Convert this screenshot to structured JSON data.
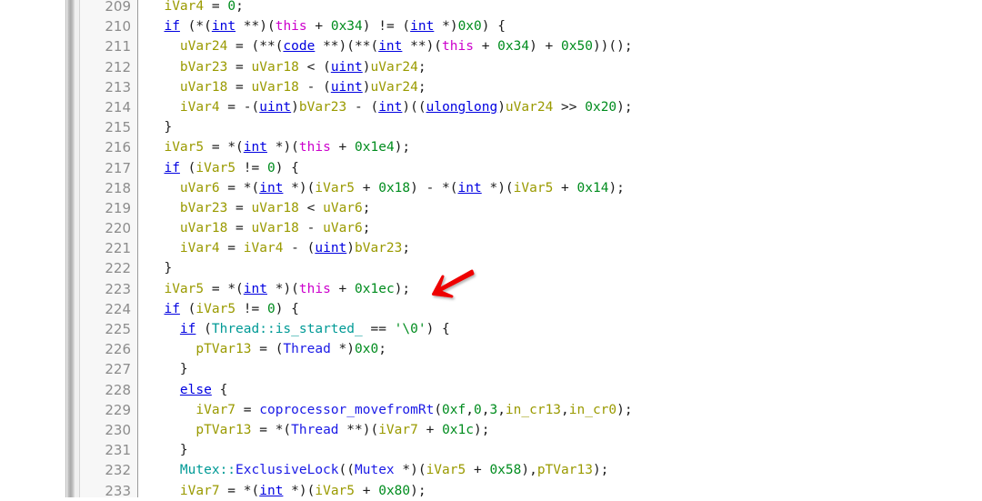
{
  "editor": {
    "kind": "decompiler-code-view",
    "first_line_number": 209,
    "last_line_number": 233,
    "colors": {
      "background": "#ffffff",
      "gutter_background": "#f7f7f7",
      "line_number": "#8c8c8c",
      "keyword": "#0000e0",
      "type": "#0000e0",
      "function": "#1a1ae6",
      "namespace": "#009a96",
      "variable": "#9a9a00",
      "number": "#008c1e",
      "this_keyword": "#cc00cc",
      "plain": "#1b1b1b",
      "annotation_arrow": "#ee0000"
    }
  },
  "annotation": {
    "type": "arrow",
    "color": "#ee0000",
    "points_at_line": 223,
    "direction": "down-left"
  },
  "lines": [
    {
      "n": "209",
      "tokens": [
        {
          "t": "  ",
          "c": "pl"
        },
        {
          "t": "iVar4",
          "c": "var"
        },
        {
          "t": " = ",
          "c": "pl"
        },
        {
          "t": "0",
          "c": "num"
        },
        {
          "t": ";",
          "c": "pl"
        }
      ]
    },
    {
      "n": "210",
      "tokens": [
        {
          "t": "  ",
          "c": "pl"
        },
        {
          "t": "if",
          "c": "kw"
        },
        {
          "t": " (*(",
          "c": "pl"
        },
        {
          "t": "int",
          "c": "ty"
        },
        {
          "t": " **)(",
          "c": "pl"
        },
        {
          "t": "this",
          "c": "this"
        },
        {
          "t": " + ",
          "c": "pl"
        },
        {
          "t": "0x34",
          "c": "num"
        },
        {
          "t": ") != (",
          "c": "pl"
        },
        {
          "t": "int",
          "c": "ty"
        },
        {
          "t": " *)",
          "c": "pl"
        },
        {
          "t": "0x0",
          "c": "num"
        },
        {
          "t": ") {",
          "c": "pl"
        }
      ]
    },
    {
      "n": "211",
      "tokens": [
        {
          "t": "    ",
          "c": "pl"
        },
        {
          "t": "uVar24",
          "c": "var"
        },
        {
          "t": " = (**(",
          "c": "pl"
        },
        {
          "t": "code",
          "c": "ty"
        },
        {
          "t": " **)(**(",
          "c": "pl"
        },
        {
          "t": "int",
          "c": "ty"
        },
        {
          "t": " **)(",
          "c": "pl"
        },
        {
          "t": "this",
          "c": "this"
        },
        {
          "t": " + ",
          "c": "pl"
        },
        {
          "t": "0x34",
          "c": "num"
        },
        {
          "t": ") + ",
          "c": "pl"
        },
        {
          "t": "0x50",
          "c": "num"
        },
        {
          "t": "))();",
          "c": "pl"
        }
      ]
    },
    {
      "n": "212",
      "tokens": [
        {
          "t": "    ",
          "c": "pl"
        },
        {
          "t": "bVar23",
          "c": "var"
        },
        {
          "t": " = ",
          "c": "pl"
        },
        {
          "t": "uVar18",
          "c": "var"
        },
        {
          "t": " < (",
          "c": "pl"
        },
        {
          "t": "uint",
          "c": "ty"
        },
        {
          "t": ")",
          "c": "pl"
        },
        {
          "t": "uVar24",
          "c": "var"
        },
        {
          "t": ";",
          "c": "pl"
        }
      ]
    },
    {
      "n": "213",
      "tokens": [
        {
          "t": "    ",
          "c": "pl"
        },
        {
          "t": "uVar18",
          "c": "var"
        },
        {
          "t": " = ",
          "c": "pl"
        },
        {
          "t": "uVar18",
          "c": "var"
        },
        {
          "t": " - (",
          "c": "pl"
        },
        {
          "t": "uint",
          "c": "ty"
        },
        {
          "t": ")",
          "c": "pl"
        },
        {
          "t": "uVar24",
          "c": "var"
        },
        {
          "t": ";",
          "c": "pl"
        }
      ]
    },
    {
      "n": "214",
      "tokens": [
        {
          "t": "    ",
          "c": "pl"
        },
        {
          "t": "iVar4",
          "c": "var"
        },
        {
          "t": " = -(",
          "c": "pl"
        },
        {
          "t": "uint",
          "c": "ty"
        },
        {
          "t": ")",
          "c": "pl"
        },
        {
          "t": "bVar23",
          "c": "var"
        },
        {
          "t": " - (",
          "c": "pl"
        },
        {
          "t": "int",
          "c": "ty"
        },
        {
          "t": ")((",
          "c": "pl"
        },
        {
          "t": "ulonglong",
          "c": "ty"
        },
        {
          "t": ")",
          "c": "pl"
        },
        {
          "t": "uVar24",
          "c": "var"
        },
        {
          "t": " >> ",
          "c": "pl"
        },
        {
          "t": "0x20",
          "c": "num"
        },
        {
          "t": ");",
          "c": "pl"
        }
      ]
    },
    {
      "n": "215",
      "tokens": [
        {
          "t": "  }",
          "c": "pl"
        }
      ]
    },
    {
      "n": "216",
      "tokens": [
        {
          "t": "  ",
          "c": "pl"
        },
        {
          "t": "iVar5",
          "c": "var"
        },
        {
          "t": " = *(",
          "c": "pl"
        },
        {
          "t": "int",
          "c": "ty"
        },
        {
          "t": " *)(",
          "c": "pl"
        },
        {
          "t": "this",
          "c": "this"
        },
        {
          "t": " + ",
          "c": "pl"
        },
        {
          "t": "0x1e4",
          "c": "num"
        },
        {
          "t": ");",
          "c": "pl"
        }
      ]
    },
    {
      "n": "217",
      "tokens": [
        {
          "t": "  ",
          "c": "pl"
        },
        {
          "t": "if",
          "c": "kw"
        },
        {
          "t": " (",
          "c": "pl"
        },
        {
          "t": "iVar5",
          "c": "var"
        },
        {
          "t": " != ",
          "c": "pl"
        },
        {
          "t": "0",
          "c": "num"
        },
        {
          "t": ") {",
          "c": "pl"
        }
      ]
    },
    {
      "n": "218",
      "tokens": [
        {
          "t": "    ",
          "c": "pl"
        },
        {
          "t": "uVar6",
          "c": "var"
        },
        {
          "t": " = *(",
          "c": "pl"
        },
        {
          "t": "int",
          "c": "ty"
        },
        {
          "t": " *)(",
          "c": "pl"
        },
        {
          "t": "iVar5",
          "c": "var"
        },
        {
          "t": " + ",
          "c": "pl"
        },
        {
          "t": "0x18",
          "c": "num"
        },
        {
          "t": ") - *(",
          "c": "pl"
        },
        {
          "t": "int",
          "c": "ty"
        },
        {
          "t": " *)(",
          "c": "pl"
        },
        {
          "t": "iVar5",
          "c": "var"
        },
        {
          "t": " + ",
          "c": "pl"
        },
        {
          "t": "0x14",
          "c": "num"
        },
        {
          "t": ");",
          "c": "pl"
        }
      ]
    },
    {
      "n": "219",
      "tokens": [
        {
          "t": "    ",
          "c": "pl"
        },
        {
          "t": "bVar23",
          "c": "var"
        },
        {
          "t": " = ",
          "c": "pl"
        },
        {
          "t": "uVar18",
          "c": "var"
        },
        {
          "t": " < ",
          "c": "pl"
        },
        {
          "t": "uVar6",
          "c": "var"
        },
        {
          "t": ";",
          "c": "pl"
        }
      ]
    },
    {
      "n": "220",
      "tokens": [
        {
          "t": "    ",
          "c": "pl"
        },
        {
          "t": "uVar18",
          "c": "var"
        },
        {
          "t": " = ",
          "c": "pl"
        },
        {
          "t": "uVar18",
          "c": "var"
        },
        {
          "t": " - ",
          "c": "pl"
        },
        {
          "t": "uVar6",
          "c": "var"
        },
        {
          "t": ";",
          "c": "pl"
        }
      ]
    },
    {
      "n": "221",
      "tokens": [
        {
          "t": "    ",
          "c": "pl"
        },
        {
          "t": "iVar4",
          "c": "var"
        },
        {
          "t": " = ",
          "c": "pl"
        },
        {
          "t": "iVar4",
          "c": "var"
        },
        {
          "t": " - (",
          "c": "pl"
        },
        {
          "t": "uint",
          "c": "ty"
        },
        {
          "t": ")",
          "c": "pl"
        },
        {
          "t": "bVar23",
          "c": "var"
        },
        {
          "t": ";",
          "c": "pl"
        }
      ]
    },
    {
      "n": "222",
      "tokens": [
        {
          "t": "  }",
          "c": "pl"
        }
      ]
    },
    {
      "n": "223",
      "tokens": [
        {
          "t": "  ",
          "c": "pl"
        },
        {
          "t": "iVar5",
          "c": "var"
        },
        {
          "t": " = *(",
          "c": "pl"
        },
        {
          "t": "int",
          "c": "ty"
        },
        {
          "t": " *)(",
          "c": "pl"
        },
        {
          "t": "this",
          "c": "this"
        },
        {
          "t": " + ",
          "c": "pl"
        },
        {
          "t": "0x1ec",
          "c": "num"
        },
        {
          "t": ");",
          "c": "pl"
        }
      ]
    },
    {
      "n": "224",
      "tokens": [
        {
          "t": "  ",
          "c": "pl"
        },
        {
          "t": "if",
          "c": "kw"
        },
        {
          "t": " (",
          "c": "pl"
        },
        {
          "t": "iVar5",
          "c": "var"
        },
        {
          "t": " != ",
          "c": "pl"
        },
        {
          "t": "0",
          "c": "num"
        },
        {
          "t": ") {",
          "c": "pl"
        }
      ]
    },
    {
      "n": "225",
      "tokens": [
        {
          "t": "    ",
          "c": "pl"
        },
        {
          "t": "if",
          "c": "kw"
        },
        {
          "t": " (",
          "c": "pl"
        },
        {
          "t": "Thread::is_started_",
          "c": "ns"
        },
        {
          "t": " == ",
          "c": "pl"
        },
        {
          "t": "'\\0'",
          "c": "num"
        },
        {
          "t": ") {",
          "c": "pl"
        }
      ]
    },
    {
      "n": "226",
      "tokens": [
        {
          "t": "      ",
          "c": "pl"
        },
        {
          "t": "pTVar13",
          "c": "var"
        },
        {
          "t": " = (",
          "c": "pl"
        },
        {
          "t": "Thread",
          "c": "fn"
        },
        {
          "t": " *)",
          "c": "pl"
        },
        {
          "t": "0x0",
          "c": "num"
        },
        {
          "t": ";",
          "c": "pl"
        }
      ]
    },
    {
      "n": "227",
      "tokens": [
        {
          "t": "    }",
          "c": "pl"
        }
      ]
    },
    {
      "n": "228",
      "tokens": [
        {
          "t": "    ",
          "c": "pl"
        },
        {
          "t": "else",
          "c": "kw"
        },
        {
          "t": " {",
          "c": "pl"
        }
      ]
    },
    {
      "n": "229",
      "tokens": [
        {
          "t": "      ",
          "c": "pl"
        },
        {
          "t": "iVar7",
          "c": "var"
        },
        {
          "t": " = ",
          "c": "pl"
        },
        {
          "t": "coprocessor_movefromRt",
          "c": "fn"
        },
        {
          "t": "(",
          "c": "pl"
        },
        {
          "t": "0xf",
          "c": "num"
        },
        {
          "t": ",",
          "c": "pl"
        },
        {
          "t": "0",
          "c": "num"
        },
        {
          "t": ",",
          "c": "pl"
        },
        {
          "t": "3",
          "c": "num"
        },
        {
          "t": ",",
          "c": "pl"
        },
        {
          "t": "in_cr13",
          "c": "var"
        },
        {
          "t": ",",
          "c": "pl"
        },
        {
          "t": "in_cr0",
          "c": "var"
        },
        {
          "t": ");",
          "c": "pl"
        }
      ]
    },
    {
      "n": "230",
      "tokens": [
        {
          "t": "      ",
          "c": "pl"
        },
        {
          "t": "pTVar13",
          "c": "var"
        },
        {
          "t": " = *(",
          "c": "pl"
        },
        {
          "t": "Thread",
          "c": "fn"
        },
        {
          "t": " **)(",
          "c": "pl"
        },
        {
          "t": "iVar7",
          "c": "var"
        },
        {
          "t": " + ",
          "c": "pl"
        },
        {
          "t": "0x1c",
          "c": "num"
        },
        {
          "t": ");",
          "c": "pl"
        }
      ]
    },
    {
      "n": "231",
      "tokens": [
        {
          "t": "    }",
          "c": "pl"
        }
      ]
    },
    {
      "n": "232",
      "tokens": [
        {
          "t": "    ",
          "c": "pl"
        },
        {
          "t": "Mutex::",
          "c": "ns"
        },
        {
          "t": "ExclusiveLock",
          "c": "fn"
        },
        {
          "t": "((",
          "c": "pl"
        },
        {
          "t": "Mutex",
          "c": "fn"
        },
        {
          "t": " *)(",
          "c": "pl"
        },
        {
          "t": "iVar5",
          "c": "var"
        },
        {
          "t": " + ",
          "c": "pl"
        },
        {
          "t": "0x58",
          "c": "num"
        },
        {
          "t": "),",
          "c": "pl"
        },
        {
          "t": "pTVar13",
          "c": "var"
        },
        {
          "t": ");",
          "c": "pl"
        }
      ]
    },
    {
      "n": "233",
      "tokens": [
        {
          "t": "    ",
          "c": "pl"
        },
        {
          "t": "iVar7",
          "c": "var"
        },
        {
          "t": " = *(",
          "c": "pl"
        },
        {
          "t": "int",
          "c": "ty"
        },
        {
          "t": " *)(",
          "c": "pl"
        },
        {
          "t": "iVar5",
          "c": "var"
        },
        {
          "t": " + ",
          "c": "pl"
        },
        {
          "t": "0x80",
          "c": "num"
        },
        {
          "t": ");",
          "c": "pl"
        }
      ]
    }
  ]
}
